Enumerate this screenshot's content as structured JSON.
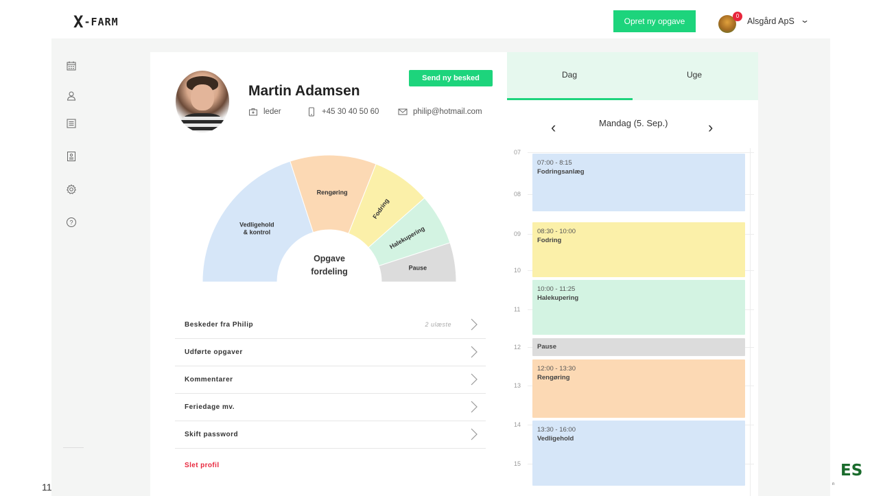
{
  "app": {
    "logo_mark": "X",
    "logo_text": "-FARM",
    "create_button": "Opret ny opgave",
    "notification_count": "0",
    "company": "Alsgård ApS"
  },
  "sidebar": {
    "items": [
      {
        "name": "calendar-icon"
      },
      {
        "name": "user-icon"
      },
      {
        "name": "list-icon"
      },
      {
        "name": "contact-card-icon"
      },
      {
        "name": "gear-icon"
      },
      {
        "name": "help-icon"
      }
    ]
  },
  "profile": {
    "name": "Martin Adamsen",
    "send_message_button": "Send ny besked",
    "role": "leder",
    "phone": "+45 30 40 50 60",
    "email": "philip@hotmail.com"
  },
  "chart_data": {
    "type": "pie",
    "title": "Opgave fordeling",
    "categories": [
      "Vedligehold & kontrol",
      "Rengøring",
      "Fodring",
      "Halekupering",
      "Pause"
    ],
    "values": [
      40,
      22,
      15,
      13,
      10
    ],
    "colors": [
      "#d6e6f8",
      "#fcd9b4",
      "#fbf0a9",
      "#d3f3e2",
      "#dcdcdc"
    ]
  },
  "menu": {
    "items": [
      {
        "label": "Beskeder fra Philip",
        "info": "2 ulæste"
      },
      {
        "label": "Udførte opgaver",
        "info": ""
      },
      {
        "label": "Kommentarer",
        "info": ""
      },
      {
        "label": "Feriedage mv.",
        "info": ""
      },
      {
        "label": "Skift password",
        "info": ""
      }
    ],
    "delete_label": "Slet profil"
  },
  "calendar": {
    "tabs": [
      "Dag",
      "Uge"
    ],
    "active_tab": "Dag",
    "date_label": "Mandag (5. Sep.)",
    "prev": "‹",
    "next": "›",
    "hours": [
      "07",
      "08",
      "09",
      "10",
      "11",
      "12",
      "13",
      "14",
      "15"
    ],
    "events": [
      {
        "time": "07:00 - 8:15",
        "title": "Fodringsanlæg",
        "color": "#d6e6f8"
      },
      {
        "time": "08:30 - 10:00",
        "title": "Fodring",
        "color": "#fbf0a9"
      },
      {
        "time": "10:00 - 11:25",
        "title": "Halekupering",
        "color": "#d3f3e2"
      },
      {
        "time": "",
        "title": "Pause",
        "color": "#dcdcdc"
      },
      {
        "time": "12:00 - 13:30",
        "title": "Rengøring",
        "color": "#fcd9b4"
      },
      {
        "time": "13:30 - 16:00",
        "title": "Vedligehold",
        "color": "#d6e6f8"
      }
    ]
  },
  "slide": {
    "page_number": "11",
    "brand": "ES",
    "brand_sub": "n"
  }
}
